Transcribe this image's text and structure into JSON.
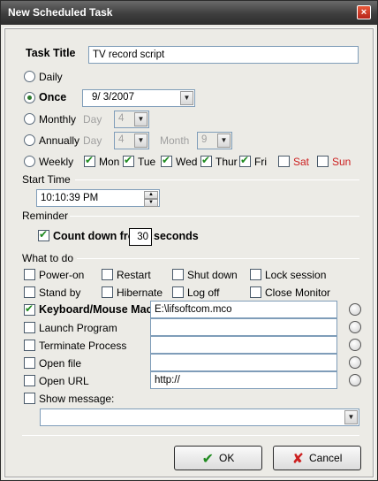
{
  "window": {
    "title": "New Scheduled Task",
    "close_glyph": "×"
  },
  "task": {
    "title_label": "Task Title",
    "title_value": "TV record script"
  },
  "schedule": {
    "daily": "Daily",
    "once": "Once",
    "once_date": "9/  3/2007",
    "monthly": "Monthly",
    "day_label": "Day",
    "monthly_day": "4",
    "annually": "Annually",
    "annually_day": "4",
    "month_label": "Month",
    "annually_month": "9",
    "weekly": "Weekly",
    "days": {
      "mon": "Mon",
      "tue": "Tue",
      "wed": "Wed",
      "thur": "Thur",
      "fri": "Fri",
      "sat": "Sat",
      "sun": "Sun"
    }
  },
  "start_time": {
    "section": "Start Time",
    "value": "10:10:39 PM"
  },
  "reminder": {
    "section": "Reminder",
    "countdown_label": "Count down fro",
    "countdown_value": "30",
    "seconds": "seconds"
  },
  "actions": {
    "section": "What to do",
    "power_on": "Power-on",
    "restart": "Restart",
    "shutdown": "Shut down",
    "lock": "Lock session",
    "standby": "Stand by",
    "hibernate": "Hibernate",
    "logoff": "Log off",
    "close_monitor": "Close Monitor",
    "macro_label": "Keyboard/Mouse Mac",
    "macro_value": "E:\\lifsoftcom.mco",
    "launch": "Launch Program",
    "terminate": "Terminate Process",
    "open_file": "Open file",
    "open_url": "Open URL",
    "url_value": "http://",
    "show_message": "Show message:"
  },
  "buttons": {
    "ok": "OK",
    "cancel": "Cancel"
  },
  "colors": {
    "weekend": "#cc2020",
    "ok_check": "#1f8a1f",
    "cancel_x": "#cc2020"
  }
}
